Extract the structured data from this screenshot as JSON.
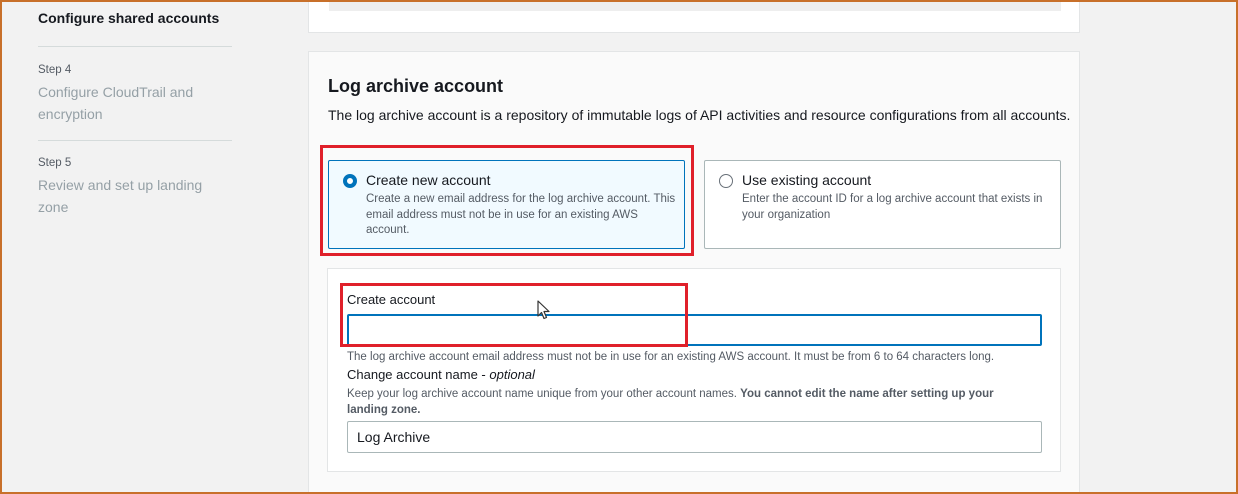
{
  "sidebar": {
    "current_step_title": "Configure shared accounts",
    "steps": [
      {
        "num": "Step 4",
        "title": "Configure CloudTrail and encryption"
      },
      {
        "num": "Step 5",
        "title": "Review and set up landing zone"
      }
    ]
  },
  "log_archive": {
    "title": "Log archive account",
    "description": "The log archive account is a repository of immutable logs of API activities and resource configurations from all accounts.",
    "options": [
      {
        "label": "Create new account",
        "description": "Create a new email address for the log archive account. This email address must not be in use for an existing AWS account.",
        "selected": true
      },
      {
        "label": "Use existing account",
        "description": "Enter the account ID for a log archive account that exists in your organization",
        "selected": false
      }
    ],
    "create_account": {
      "label": "Create account",
      "value": "",
      "hint": "The log archive account email address must not be in use for an existing AWS account. It must be from 6 to 64 characters long."
    },
    "account_name": {
      "label": "Change account name",
      "optional": "optional",
      "hint_normal": "Keep your log archive account name unique from your other account names. ",
      "hint_bold": "You cannot edit the name after setting up your landing zone.",
      "value": "Log Archive"
    }
  },
  "colors": {
    "accent": "#0073bb",
    "annotation_red": "#e0202a",
    "frame": "#c8702a"
  },
  "icons": {
    "cursor": "mouse-pointer-icon"
  }
}
